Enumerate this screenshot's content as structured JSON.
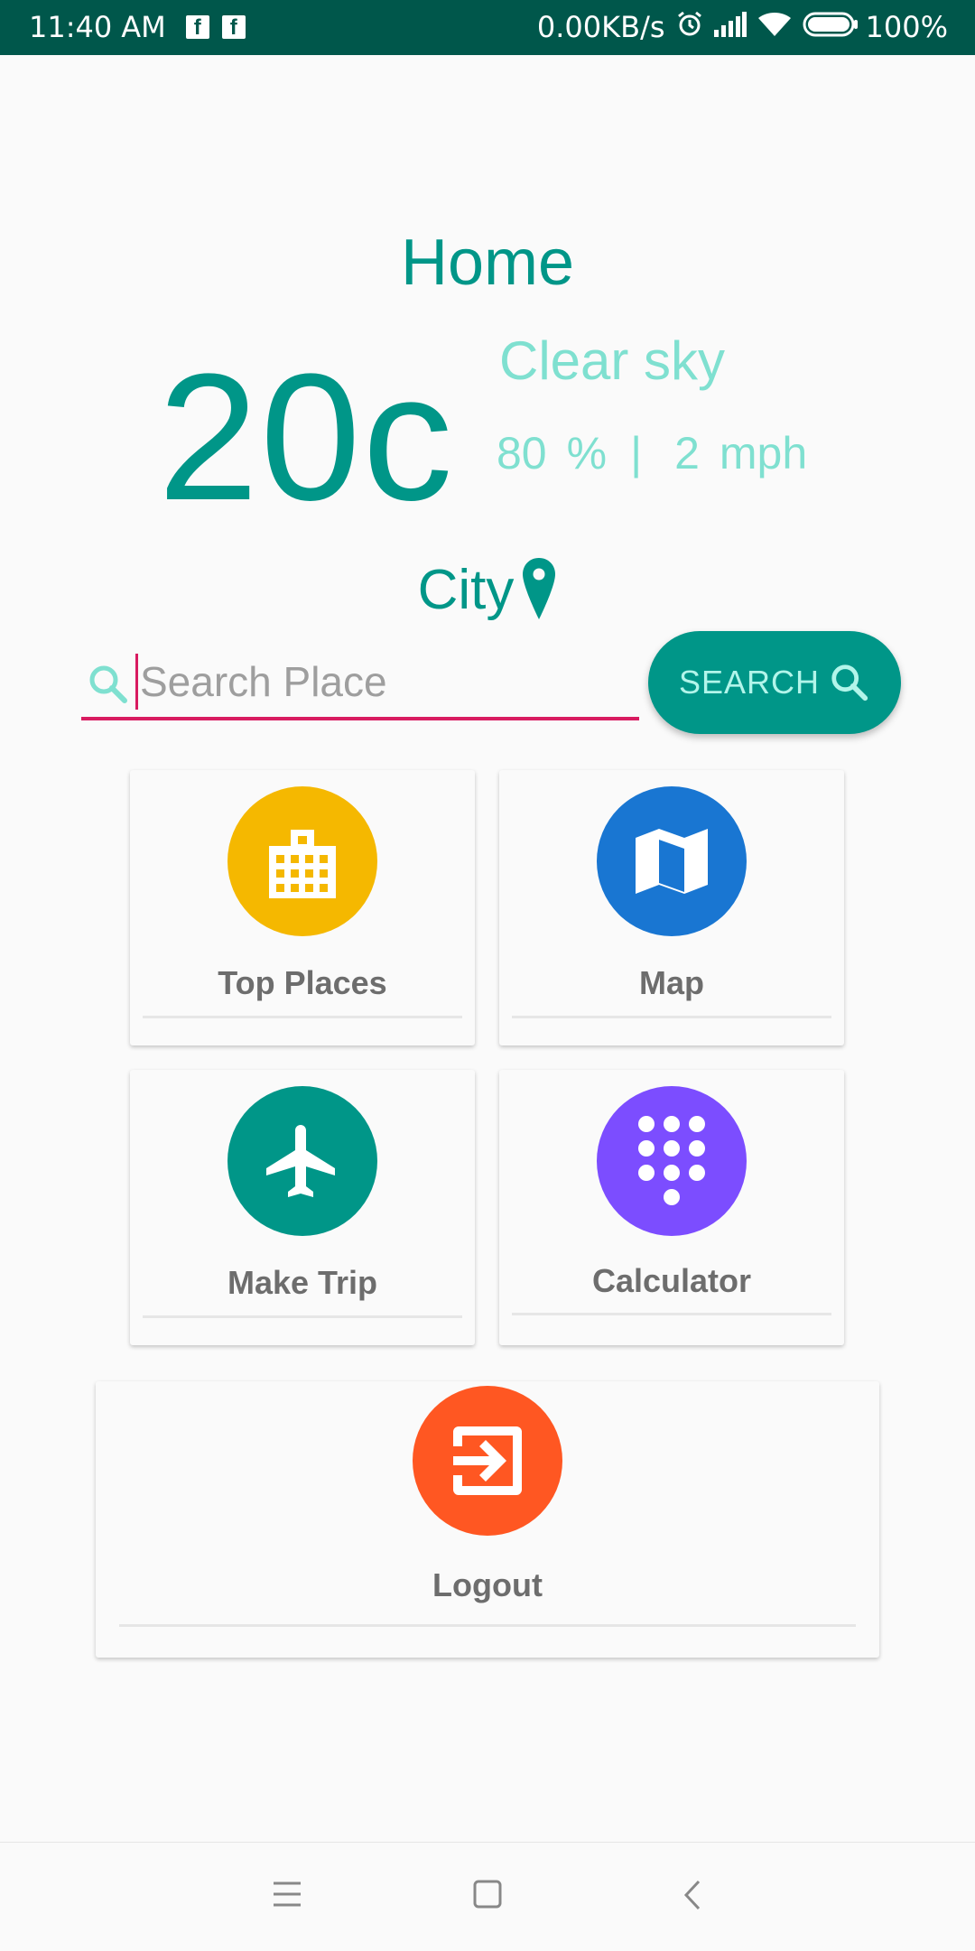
{
  "status_bar": {
    "time": "11:40",
    "ampm": "AM",
    "notif_1": "f",
    "notif_2": "f",
    "network_speed": "0.00KB/s",
    "battery": "100%"
  },
  "screen_title": "Home",
  "weather": {
    "temperature": "20c",
    "description": "Clear sky",
    "humidity_value": "80",
    "humidity_unit": "%",
    "separator": "|",
    "wind_value": "2",
    "wind_unit": "mph",
    "city": "City"
  },
  "search": {
    "placeholder": "Search Place",
    "value": "",
    "button_label": "SEARCH"
  },
  "menu": {
    "top_places": {
      "label": "Top Places",
      "color": "#f5b800",
      "icon": "city-building-icon"
    },
    "map": {
      "label": "Map",
      "color": "#1976d2",
      "icon": "map-icon"
    },
    "make_trip": {
      "label": "Make Trip",
      "color": "#009688",
      "icon": "airplane-icon"
    },
    "calculator": {
      "label": "Calculator",
      "color": "#7c4dff",
      "icon": "dialpad-icon"
    },
    "logout": {
      "label": "Logout",
      "color": "#ff5722",
      "icon": "exit-icon"
    }
  },
  "colors": {
    "primary": "#009688",
    "primary_dark": "#00574b",
    "accent": "#d81b60",
    "secondary_text": "#7fe0d0"
  }
}
